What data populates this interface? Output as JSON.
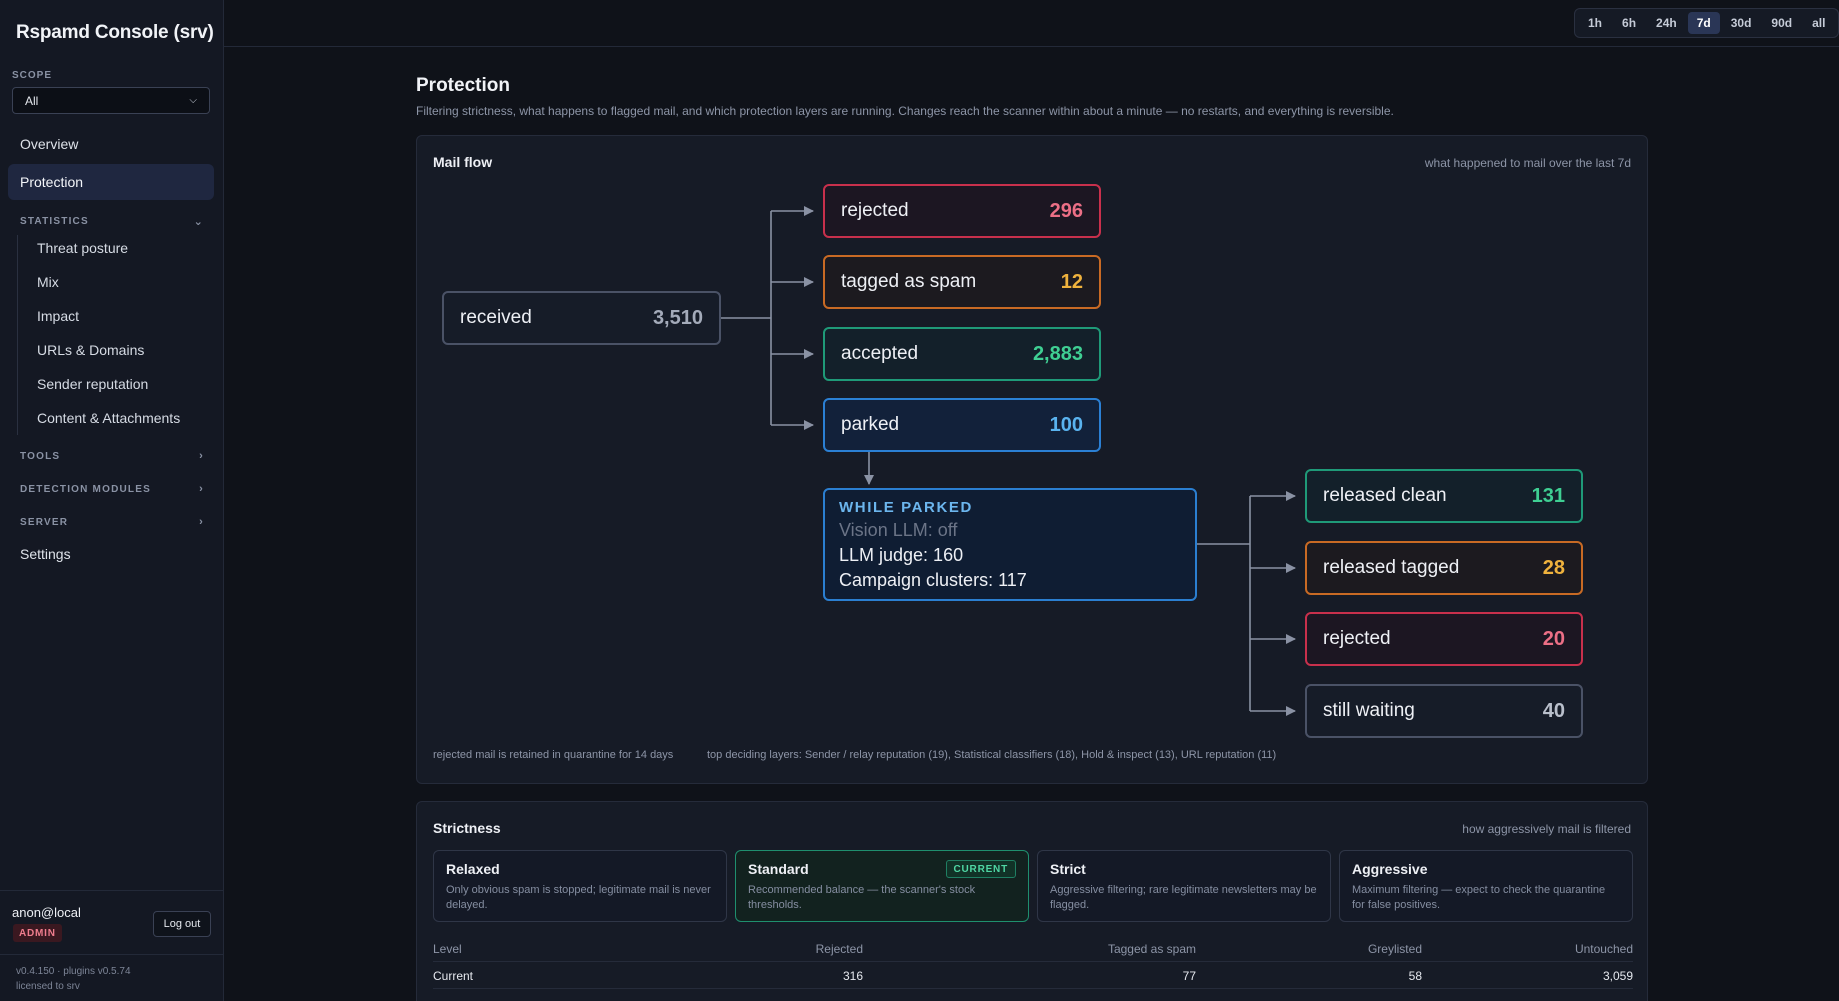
{
  "app": {
    "title": "Rspamd Console (srv)"
  },
  "sidebar": {
    "scope_label": "SCOPE",
    "scope_value": "All",
    "nav": [
      {
        "label": "Overview",
        "active": false
      },
      {
        "label": "Protection",
        "active": true
      }
    ],
    "statistics": {
      "label": "STATISTICS",
      "items": [
        "Threat posture",
        "Mix",
        "Impact",
        "URLs & Domains",
        "Sender reputation",
        "Content & Attachments"
      ]
    },
    "tools_label": "TOOLS",
    "detection_label": "DETECTION MODULES",
    "server_label": "SERVER",
    "settings_label": "Settings",
    "user": {
      "name": "anon@local",
      "role": "ADMIN",
      "logout_label": "Log out"
    },
    "version": "v0.4.150 · plugins v0.5.74",
    "license": "licensed to srv"
  },
  "topbar": {
    "ranges": [
      "1h",
      "6h",
      "24h",
      "7d",
      "30d",
      "90d",
      "all"
    ],
    "active_range": "7d"
  },
  "page": {
    "title": "Protection",
    "subtitle": "Filtering strictness, what happens to flagged mail, and which protection layers are running. Changes reach the scanner within about a minute — no restarts, and everything is reversible."
  },
  "mail_flow": {
    "title": "Mail flow",
    "hint": "what happened to mail over the last 7d",
    "received": {
      "label": "received",
      "value": "3,510"
    },
    "outcomes": [
      {
        "label": "rejected",
        "value": "296",
        "color": "#c8304c"
      },
      {
        "label": "tagged as spam",
        "value": "12",
        "color": "#c86a24"
      },
      {
        "label": "accepted",
        "value": "2,883",
        "color": "#1f9a78"
      },
      {
        "label": "parked",
        "value": "100",
        "color": "#2b80d4"
      }
    ],
    "while_parked": {
      "title": "WHILE PARKED",
      "vision": "Vision LLM: off",
      "llm_judge": "LLM judge: 160",
      "campaign": "Campaign clusters: 117"
    },
    "parked_outcomes": [
      {
        "label": "released clean",
        "value": "131",
        "color": "#1f9a78"
      },
      {
        "label": "released tagged",
        "value": "28",
        "color": "#c86a24"
      },
      {
        "label": "rejected",
        "value": "20",
        "color": "#c8304c"
      },
      {
        "label": "still waiting",
        "value": "40",
        "color": "#4a5266"
      }
    ],
    "footer_retention": "rejected mail is retained in quarantine for 14 days",
    "footer_layers": "top deciding layers: Sender / relay reputation (19), Statistical classifiers (18), Hold & inspect (13), URL reputation (11)"
  },
  "strictness": {
    "title": "Strictness",
    "hint": "how aggressively mail is filtered",
    "current_badge": "CURRENT",
    "levels": [
      {
        "name": "Relaxed",
        "desc": "Only obvious spam is stopped; legitimate mail is never delayed."
      },
      {
        "name": "Standard",
        "desc": "Recommended balance — the scanner's stock thresholds."
      },
      {
        "name": "Strict",
        "desc": "Aggressive filtering; rare legitimate newsletters may be flagged."
      },
      {
        "name": "Aggressive",
        "desc": "Maximum filtering — expect to check the quarantine for false positives."
      }
    ],
    "table": {
      "headers": [
        "Level",
        "Rejected",
        "Tagged as spam",
        "Greylisted",
        "Untouched"
      ],
      "rows": [
        [
          "Current",
          "316",
          "77",
          "58",
          "3,059"
        ]
      ]
    }
  }
}
